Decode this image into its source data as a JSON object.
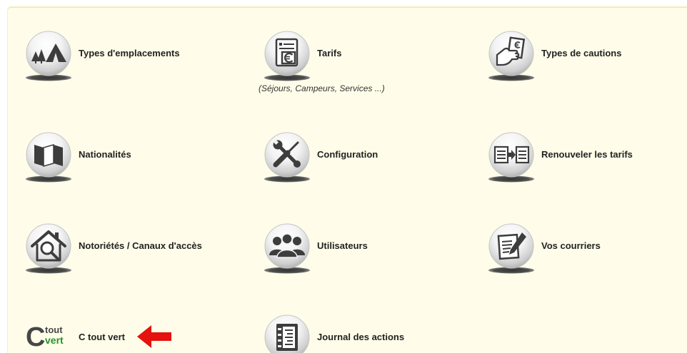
{
  "colors": {
    "page_background": "#ffffff",
    "panel_background": "#fffde9",
    "label_text": "#222222",
    "icon_glyph": "#3d3d3d",
    "logo_green": "#24922c",
    "arrow": "#e5120e"
  },
  "menu": {
    "items": [
      {
        "label": "Types d'emplacements",
        "icon": "tent-icon"
      },
      {
        "label": "Tarifs",
        "sublabel": "(Séjours, Campeurs, Services ...)",
        "icon": "euro-document-icon"
      },
      {
        "label": "Types de cautions",
        "icon": "hand-document-icon"
      },
      {
        "label": "Nationalités",
        "icon": "map-icon"
      },
      {
        "label": "Configuration",
        "icon": "tools-icon"
      },
      {
        "label": "Renouveler les tarifs",
        "icon": "renew-documents-icon"
      },
      {
        "label": "Notoriétés / Canaux d'accès",
        "icon": "house-search-icon"
      },
      {
        "label": "Utilisateurs",
        "icon": "users-icon"
      },
      {
        "label": "Vos courriers",
        "icon": "letter-pen-icon"
      },
      {
        "label": "C tout vert",
        "icon": "c-tout-vert-logo",
        "logo": {
          "big": "C",
          "top": "tout",
          "bottom": "vert"
        }
      },
      {
        "label": "Journal des actions",
        "icon": "journal-icon"
      }
    ]
  },
  "annotation": {
    "shape": "arrow-left",
    "color": "#e5120e"
  }
}
